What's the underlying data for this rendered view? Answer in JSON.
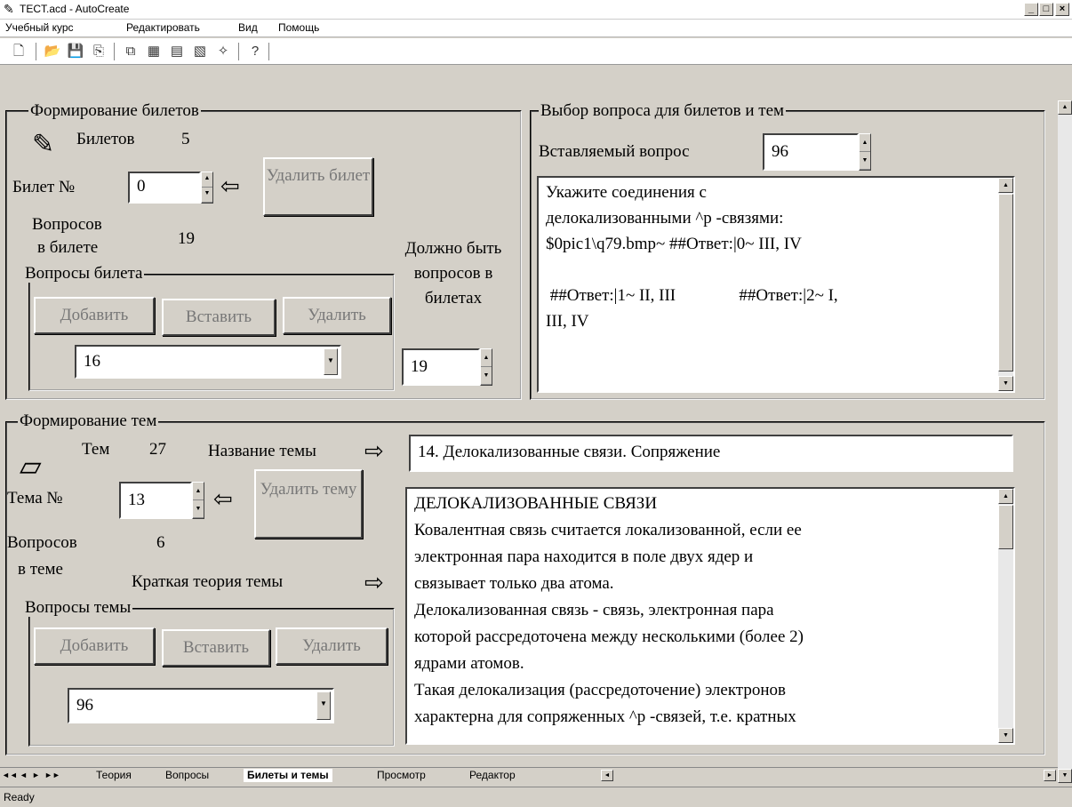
{
  "window": {
    "title": "TECT.acd - AutoCreate",
    "min": "_",
    "max": "□",
    "close": "×"
  },
  "menu": [
    "Учебный курс",
    "Редактировать",
    "Вид",
    "Помощь"
  ],
  "tickets": {
    "legend": "Формирование билетов",
    "count_label": "Билетов",
    "count_value": "5",
    "ticket_no_label": "Билет №",
    "ticket_no_value": "0",
    "delete_button": "Удалить билет",
    "questions_in_ticket_label_1": "Вопросов",
    "questions_in_ticket_label_2": "в билете",
    "questions_in_ticket_value": "19",
    "questions_group_legend": "Вопросы билета",
    "add_button": "Добавить",
    "insert_button": "Вставить",
    "remove_button": "Удалить",
    "selected_question": "16",
    "must_be_label": "Должно быть вопросов в билетах",
    "must_be_value": "19"
  },
  "question_select": {
    "legend": "Выбор вопроса для билетов и тем",
    "insert_label": "Вставляемый вопрос",
    "insert_value": "96",
    "text_lines": [
      "Укажите соединения с",
      "делокализованными ^p -связями:",
      "$0pic1\\q79.bmp~ ##Ответ:|0~ III, IV",
      "",
      " ##Ответ:|1~ II, III               ##Ответ:|2~ I,",
      "III, IV"
    ]
  },
  "topics": {
    "legend": "Формирование тем",
    "count_label": "Тем",
    "count_value": "27",
    "name_label": "Название темы",
    "name_value": "14. Делокализованные связи. Сопряжение",
    "topic_no_label": "Тема №",
    "topic_no_value": "13",
    "delete_button": "Удалить тему",
    "questions_label_1": "Вопросов",
    "questions_label_2": "в теме",
    "questions_value": "6",
    "theory_label": "Краткая теория темы",
    "questions_group_legend": "Вопросы темы",
    "add_button": "Добавить",
    "insert_button": "Вставить",
    "remove_button": "Удалить",
    "selected_question": "96",
    "theory_lines": [
      "ДЕЛОКАЛИЗОВАННЫЕ  СВЯЗИ",
      "Ковалентная связь считается локализованной, если ее",
      "электронная пара находится в поле двух ядер и",
      "связывает только два атома.",
      "Делокализованная связь - связь, электронная пара",
      "которой рассредоточена между несколькими (более 2)",
      "ядрами атомов.",
      "Такая делокализация (рассредоточение) электронов",
      "характерна для сопряженных ^p -связей, т.е. кратных"
    ]
  },
  "tabs": [
    "Теория",
    "Вопросы",
    "Билеты и темы",
    "Просмотр",
    "Редактор"
  ],
  "tab_nav": [
    "◄◄",
    "◄",
    "►",
    "►►"
  ],
  "status": "Ready"
}
